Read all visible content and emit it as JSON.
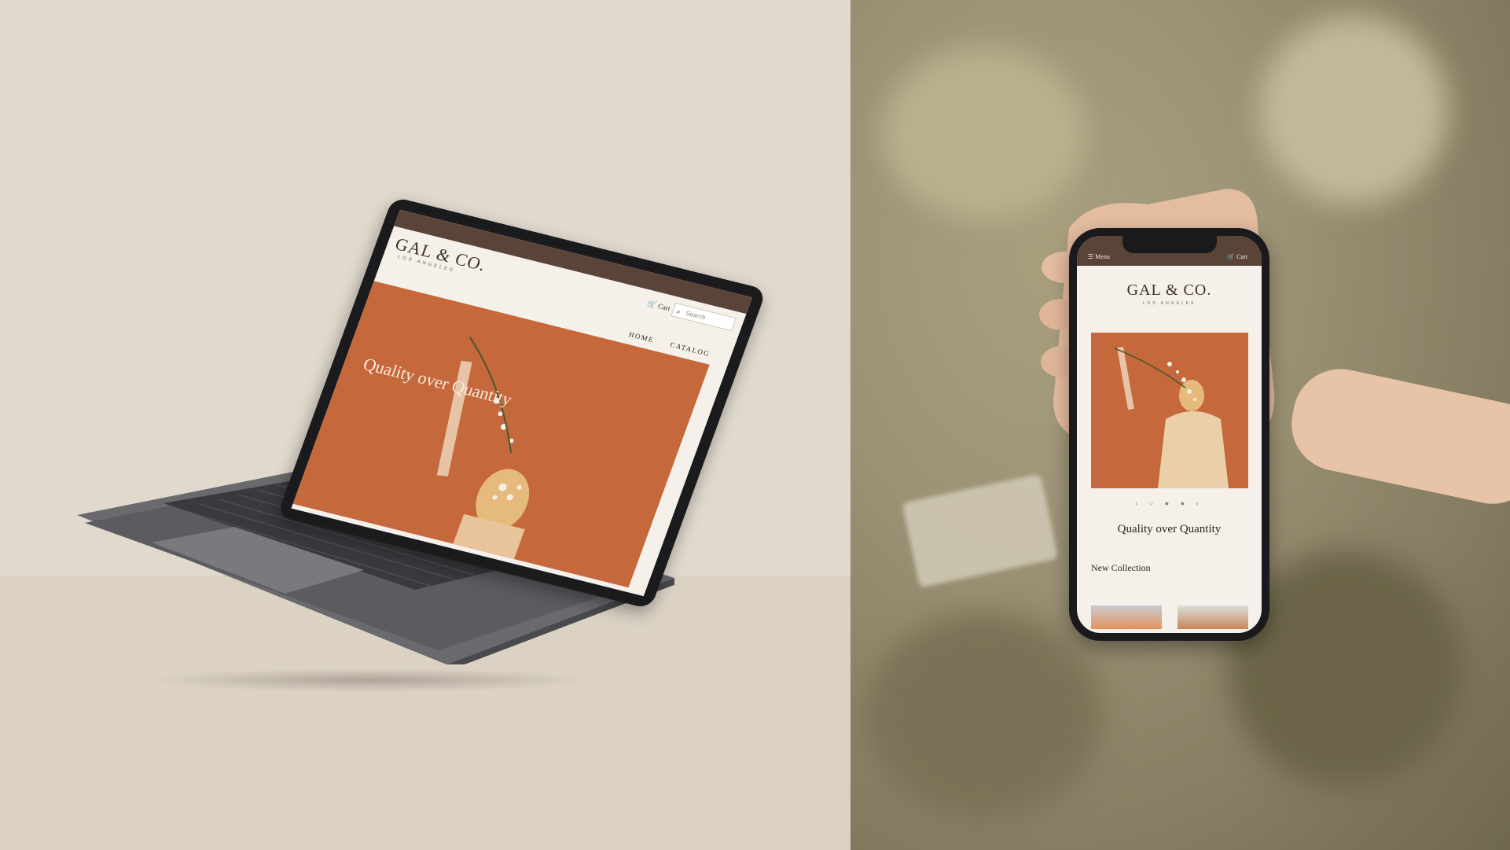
{
  "brand": {
    "name": "GAL & CO.",
    "location": "LOS ANGELES"
  },
  "desktop": {
    "cart_label": "Cart",
    "search_placeholder": "Search",
    "nav": [
      "HOME",
      "CATALOG"
    ],
    "hero_title": "Quality over Quantity"
  },
  "mobile": {
    "menu_label": "Menu",
    "cart_label": "Cart",
    "slider_dots": "‹ ○ ● ● ›",
    "hero_title": "Quality over Quantity",
    "section_title": "New Collection"
  },
  "colors": {
    "header_brown": "#5a4438",
    "hero_terracotta": "#c5683c",
    "page_cream": "#f5f1ea"
  }
}
